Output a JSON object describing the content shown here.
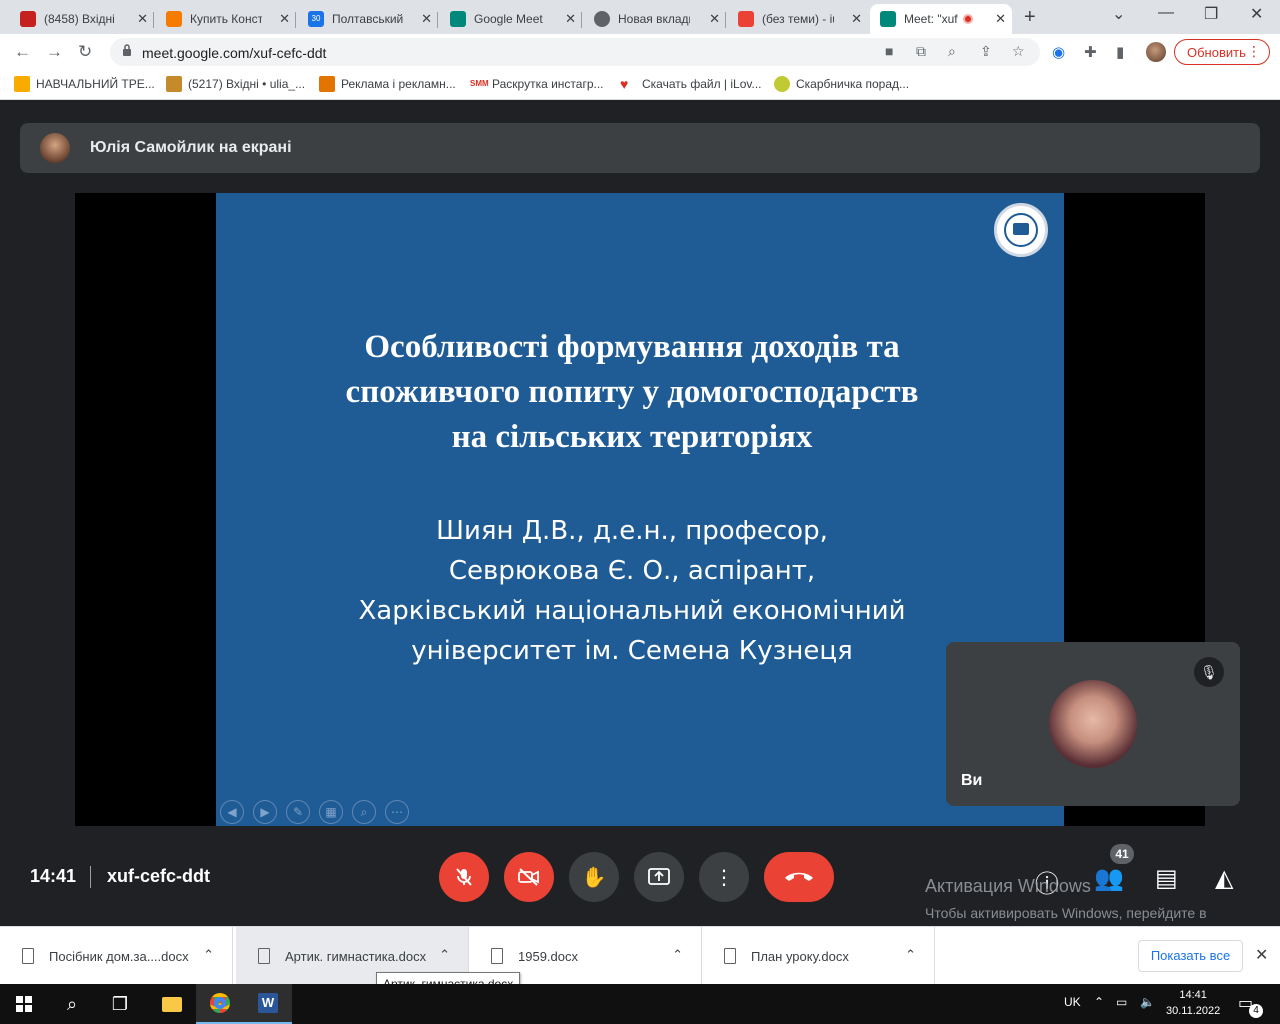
{
  "browser": {
    "tabs": [
      {
        "label": "(8458) Вхідні •",
        "icon_color": "#c5221f",
        "icon": "mail-icon"
      },
      {
        "label": "Купить Констр",
        "icon_color": "#f57c00",
        "icon": "shop-icon"
      },
      {
        "label": "Полтавський д",
        "icon_color": "#1a73e8",
        "icon": "calendar-icon",
        "icon_text": "30"
      },
      {
        "label": "Google Meet",
        "icon_color": "#00897b",
        "icon": "meet-icon"
      },
      {
        "label": "Новая вкладка",
        "icon_color": "#5f6368",
        "icon": "chrome-icon"
      },
      {
        "label": "(без теми) - iu",
        "icon_color": "#ea4335",
        "icon": "gmail-icon"
      },
      {
        "label": "Meet: \"xuf",
        "icon_color": "#00897b",
        "icon": "meet-icon",
        "active": true,
        "recording": true
      }
    ],
    "url": "meet.google.com/xuf-cefc-ddt",
    "update_label": "Обновить",
    "bookmarks": [
      {
        "label": "НАВЧАЛЬНИЙ ТРЕ...",
        "icon_color": "#f9ab00"
      },
      {
        "label": "(5217) Вхідні • ulia_...",
        "icon_color": "#c58b2b"
      },
      {
        "label": "Реклама і рекламн...",
        "icon_color": "#e37400"
      },
      {
        "label": "Раскрутка инстагр...",
        "icon_color": "#d93025",
        "icon_text": "SMM"
      },
      {
        "label": "Скачать файл | iLov...",
        "icon_color": "#d93025"
      },
      {
        "label": "Скарбничка порад...",
        "icon_color": "#c0ca33"
      }
    ]
  },
  "meet": {
    "presenter_title": "Юлія Самойлик на екрані",
    "slide": {
      "title": "Особливості формування доходів та\nспоживчого попиту у домогосподарств\nна сільських  територіях",
      "authors": [
        "Шиян Д.В., д.е.н., професор,",
        "Севрюкова Є. О., аспірант,",
        "Харківський національний економічний",
        "університет ім. Семена Кузнеця"
      ],
      "bg_color": "#1f5b95"
    },
    "self_tile": {
      "name": "Ви"
    },
    "clock": "14:41",
    "meeting_code": "xuf-cefc-ddt",
    "participants_count": "41",
    "watermark": {
      "line1": "Активация Windows",
      "line2": "Чтобы активировать Windows, перейдите в раздел \"Параметры\"."
    }
  },
  "downloads": {
    "items": [
      "Посібник дом.за....docx",
      "Артик. гимнастика.docx",
      "1959.docx",
      "План уроку.docx"
    ],
    "show_all": "Показать все",
    "tooltip": "Артик. гимнастика.docx"
  },
  "taskbar": {
    "lang": "UK",
    "time": "14:41",
    "date": "30.11.2022",
    "notifications": "4"
  }
}
